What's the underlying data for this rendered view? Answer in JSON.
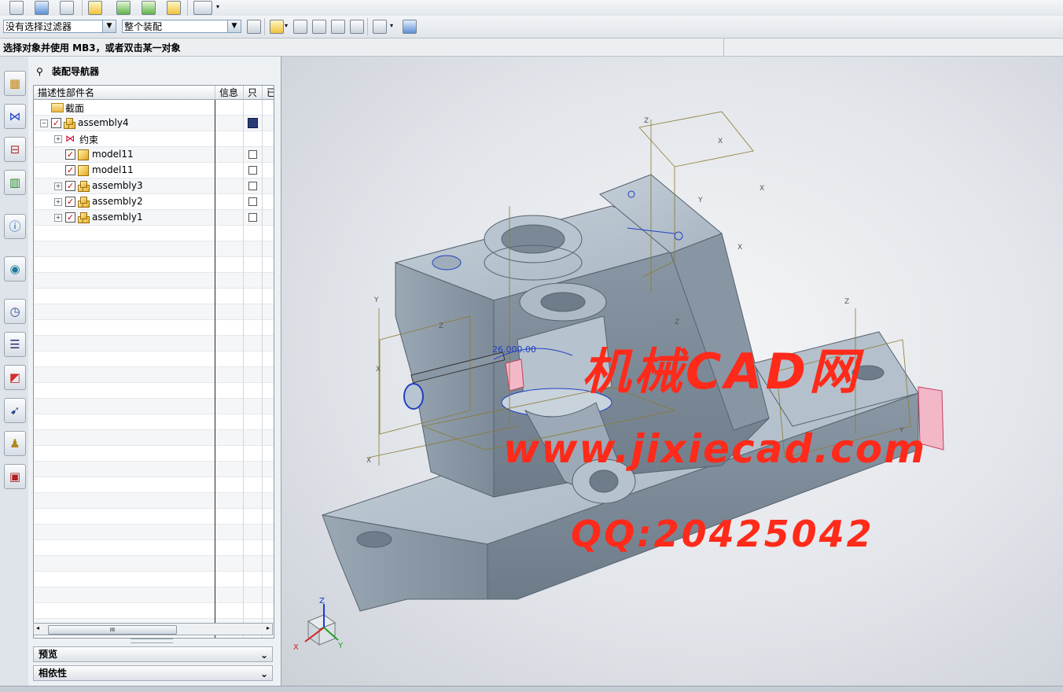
{
  "toolbar": {
    "selection_filter": "没有选择过滤器",
    "scope": "整个装配"
  },
  "cue_line": "选择对象并使用 MB3，或者双击某一对象",
  "navigator": {
    "title": "装配导航器",
    "columns": [
      "描述性部件名",
      "信息",
      "只",
      "已"
    ],
    "rows": [
      {
        "label": "截面",
        "icon": "folder-icon",
        "checked": false,
        "expander": false
      },
      {
        "label": "assembly4",
        "icon": "assembly-icon",
        "checked": true,
        "expander": "−",
        "save": true
      },
      {
        "label": "约束",
        "icon": "constraint-icon",
        "checked": false,
        "expander": "+"
      },
      {
        "label": "model11",
        "icon": "part-icon",
        "checked": true,
        "expander": false,
        "readonly_box": true
      },
      {
        "label": "model11",
        "icon": "part-icon",
        "checked": true,
        "expander": false,
        "readonly_box": true
      },
      {
        "label": "assembly3",
        "icon": "assembly-icon",
        "checked": true,
        "expander": "+",
        "readonly_box": true
      },
      {
        "label": "assembly2",
        "icon": "assembly-icon",
        "checked": true,
        "expander": "+",
        "readonly_box": true
      },
      {
        "label": "assembly1",
        "icon": "assembly-icon",
        "checked": true,
        "expander": "+",
        "readonly_box": true
      }
    ],
    "scroll_thumb": "III",
    "sections": [
      "预览",
      "相依性"
    ]
  },
  "viewport": {
    "dimension_label": "26.000.00",
    "watermark": {
      "line1": "机械CAD网",
      "line2": "www.jixiecad.com",
      "line3": "QQ:20425042"
    },
    "triad": {
      "x": "X",
      "y": "Y",
      "z": "Z"
    },
    "colors": {
      "model": "#a9b6c2",
      "watermark": "#ff2a1a",
      "background": "#e4e7eb"
    }
  }
}
